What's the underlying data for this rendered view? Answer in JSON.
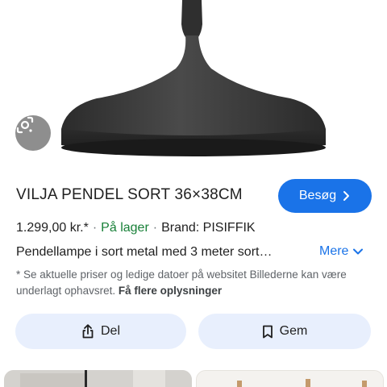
{
  "product": {
    "title": "VILJA PENDEL SORT 36×38CM",
    "price": "1.299,00 kr.*",
    "stock": "På lager",
    "brand": "Brand: PISIFFIK",
    "description": "Pendellampe i sort metal med 3 meter sort…"
  },
  "buttons": {
    "visit": "Besøg",
    "more": "Mere",
    "share": "Del",
    "save": "Gem"
  },
  "disclaimer": {
    "text": "* Se aktuelle priser og ledige datoer på websitet Billederne kan være underlagt ophavsret. ",
    "link": "Få flere oplysninger"
  },
  "icons": {
    "lens": "google-lens-icon",
    "visit_chevron": "chevron-right-icon",
    "more_chevron": "chevron-down-icon",
    "share": "share-icon",
    "save": "bookmark-icon"
  },
  "colors": {
    "accent": "#1a73e8",
    "stock": "#188038",
    "action_bg": "#e8effd",
    "lamp": "#3a3a3a"
  }
}
